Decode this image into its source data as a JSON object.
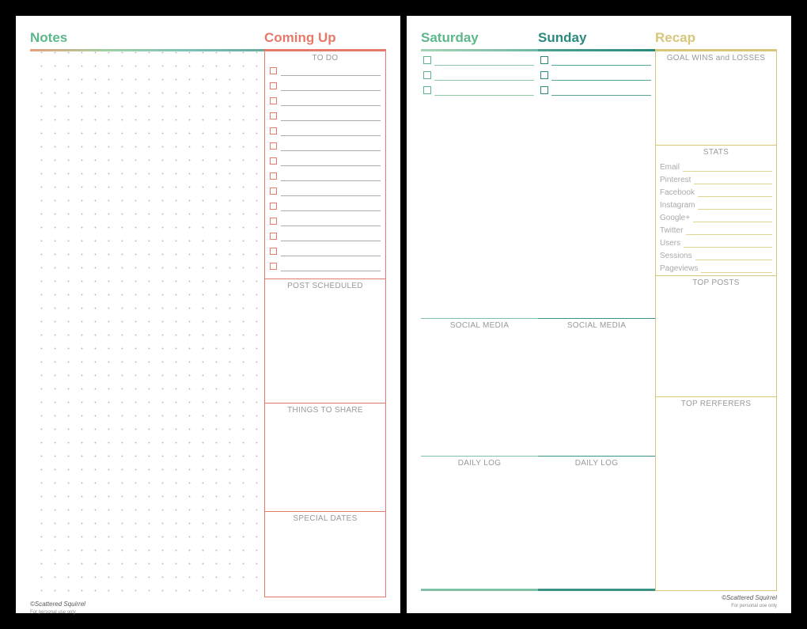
{
  "left": {
    "notes_title": "Notes",
    "coming_title": "Coming Up",
    "todo_label": "TO DO",
    "posts_label": "POST SCHEDULED",
    "things_label": "THINGS TO SHARE",
    "dates_label": "SPECIAL DATES",
    "todo_count": 14
  },
  "right": {
    "sat_title": "Saturday",
    "sun_title": "Sunday",
    "recap_title": "Recap",
    "social_label": "SOCIAL MEDIA",
    "daily_label": "DAILY LOG",
    "goal_label": "GOAL WINS and LOSSES",
    "stats_label": "STATS",
    "topposts_label": "TOP POSTS",
    "topref_label": "TOP RERFERERS",
    "stats": [
      "Email",
      "Pinterest",
      "Facebook",
      "Instagram",
      "Google+",
      "Twitter",
      "Users",
      "Sessions",
      "Pageviews"
    ],
    "day_checks": 3
  },
  "footer": {
    "brand": "©Scattered Squirrel",
    "sub": "For personal use only"
  }
}
